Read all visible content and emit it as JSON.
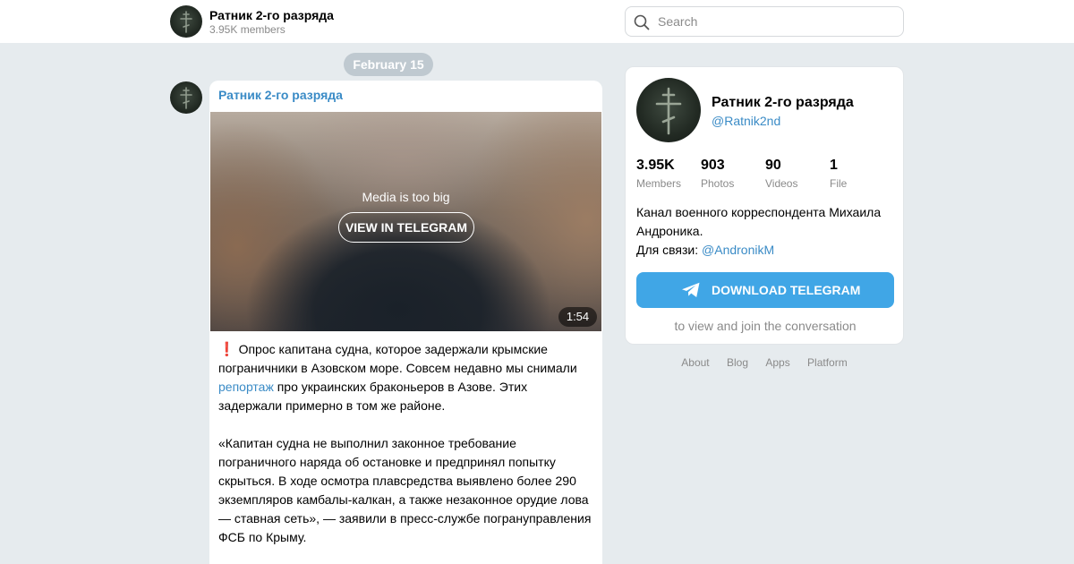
{
  "header": {
    "title": "Ратник 2-го разряда",
    "subtitle": "3.95K members",
    "search_placeholder": "Search"
  },
  "feed": {
    "date": "February 15",
    "post": {
      "author": "Ратник 2-го разряда",
      "media": {
        "notice": "Media is too big",
        "button": "VIEW IN TELEGRAM",
        "duration": "1:54"
      },
      "text": {
        "emoji": "❗",
        "p1_before_link": "Опрос капитана судна, которое задержали крымские пограничники в Азовском море. Совсем недавно мы снимали ",
        "p1_link": "репортаж",
        "p1_after_link": " про украинских браконьеров в Азове. Этих задержали примерно в том же районе.",
        "p2": "«Капитан судна не выполнил законное требование пограничного наряда об остановке и предпринял попытку скрыться. В ходе осмотра плавсредства выявлено более 290 экземпляров камбалы-калкан, а также незаконное орудие лова — ставная сеть», — заявили в пресс-службе погрануправления ФСБ по Крыму."
      }
    }
  },
  "channel": {
    "title": "Ратник 2-го разряда",
    "username": "@Ratnik2nd",
    "stats": [
      {
        "value": "3.95K",
        "label": "Members"
      },
      {
        "value": "903",
        "label": "Photos"
      },
      {
        "value": "90",
        "label": "Videos"
      },
      {
        "value": "1",
        "label": "File"
      }
    ],
    "description_line": "Канал военного корреспондента Михаила Андроника.",
    "contact_label": "Для связи: ",
    "contact_link": "@AndronikM",
    "download_button": "DOWNLOAD TELEGRAM",
    "join_text": "to view and join the conversation"
  },
  "footer": {
    "links": [
      "About",
      "Blog",
      "Apps",
      "Platform"
    ]
  },
  "colors": {
    "accent": "#3a8bc6",
    "button": "#40a6e6",
    "background": "#e6ebee"
  }
}
